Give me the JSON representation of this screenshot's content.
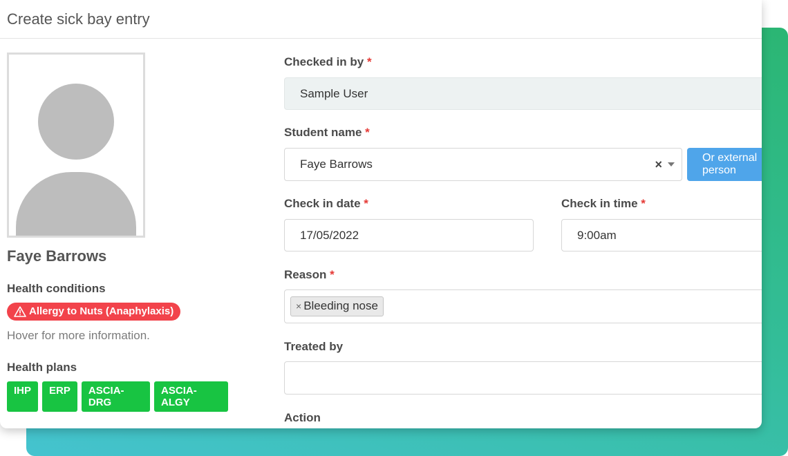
{
  "window": {
    "title": "Create sick bay entry"
  },
  "student": {
    "name": "Faye Barrows",
    "health_conditions_label": "Health conditions",
    "conditions": [
      "Allergy to Nuts (Anaphylaxis)"
    ],
    "hover_hint": "Hover for more information.",
    "health_plans_label": "Health plans",
    "plans": [
      "IHP",
      "ERP",
      "ASCIA-DRG",
      "ASCIA-ALGY"
    ]
  },
  "form": {
    "required_marker": "*",
    "checked_in_by": {
      "label": "Checked in by",
      "value": "Sample User"
    },
    "student_name": {
      "label": "Student name",
      "value": "Faye Barrows",
      "clear_symbol": "×"
    },
    "external_button": {
      "label": "Or external person"
    },
    "check_in_date": {
      "label": "Check in date",
      "value": "17/05/2022"
    },
    "check_in_time": {
      "label": "Check in time",
      "value": "9:00am"
    },
    "reason": {
      "label": "Reason",
      "tags": [
        {
          "remove_symbol": "×",
          "label": "Bleeding nose"
        }
      ]
    },
    "treated_by": {
      "label": "Treated by",
      "value": ""
    },
    "action": {
      "label": "Action"
    }
  },
  "colors": {
    "danger": "#f2434b",
    "success": "#18c442",
    "primary": "#4fa5ea",
    "gradient_start": "#2bb673",
    "gradient_end": "#45c3cf"
  }
}
